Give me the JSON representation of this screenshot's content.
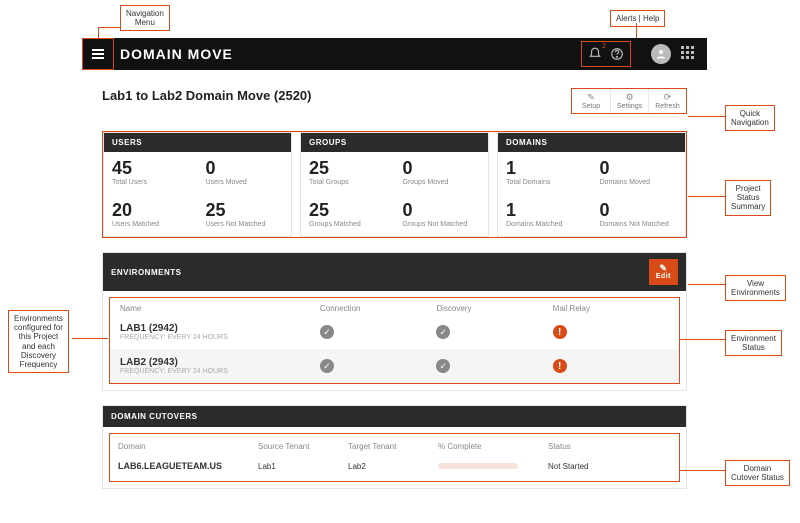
{
  "header": {
    "brand": "DOMAIN MOVE",
    "alert_count": "2"
  },
  "page": {
    "title": "Lab1 to Lab2 Domain Move (2520)"
  },
  "quicknav": {
    "setup": "Setup",
    "settings": "Settings",
    "refresh": "Refresh"
  },
  "summary": {
    "users": {
      "title": "USERS",
      "total_val": "45",
      "total_lbl": "Total Users",
      "moved_val": "0",
      "moved_lbl": "Users Moved",
      "matched_val": "20",
      "matched_lbl": "Users Matched",
      "notmatched_val": "25",
      "notmatched_lbl": "Users Not Matched"
    },
    "groups": {
      "title": "GROUPS",
      "total_val": "25",
      "total_lbl": "Total Groups",
      "moved_val": "0",
      "moved_lbl": "Groups Moved",
      "matched_val": "25",
      "matched_lbl": "Groups Matched",
      "notmatched_val": "0",
      "notmatched_lbl": "Groups Not Matched"
    },
    "domains": {
      "title": "DOMAINS",
      "total_val": "1",
      "total_lbl": "Total Domains",
      "moved_val": "0",
      "moved_lbl": "Domains Moved",
      "matched_val": "1",
      "matched_lbl": "Domains Matched",
      "notmatched_val": "0",
      "notmatched_lbl": "Domains Not Matched"
    }
  },
  "environments": {
    "title": "ENVIRONMENTS",
    "edit_label": "Edit",
    "cols": {
      "name": "Name",
      "connection": "Connection",
      "discovery": "Discovery",
      "mail": "Mail Relay"
    },
    "rows": [
      {
        "name": "LAB1 (2942)",
        "freq": "FREQUENCY: EVERY 24 HOURS",
        "connection": "ok",
        "discovery": "ok",
        "mail": "warn"
      },
      {
        "name": "LAB2 (2943)",
        "freq": "FREQUENCY: EVERY 24 HOURS",
        "connection": "ok",
        "discovery": "ok",
        "mail": "warn"
      }
    ]
  },
  "cutovers": {
    "title": "DOMAIN CUTOVERS",
    "cols": {
      "domain": "Domain",
      "source": "Source Tenant",
      "target": "Target Tenant",
      "pct": "% Complete",
      "status": "Status"
    },
    "row": {
      "domain": "LAB6.LEAGUETEAM.US",
      "source": "Lab1",
      "target": "Lab2",
      "status": "Not Started"
    }
  },
  "callouts": {
    "nav": "Navigation\nMenu",
    "alerts": "Alerts | Help",
    "quicknav": "Quick\nNavigation",
    "summary": "Project\nStatus\nSummary",
    "viewenv": "View\nEnvironments",
    "envstatus": "Environment\nStatus",
    "envconf": "Environments\nconfigured for\nthis Project\nand each\nDiscovery\nFrequency",
    "cutstatus": "Domain\nCutover Status"
  }
}
